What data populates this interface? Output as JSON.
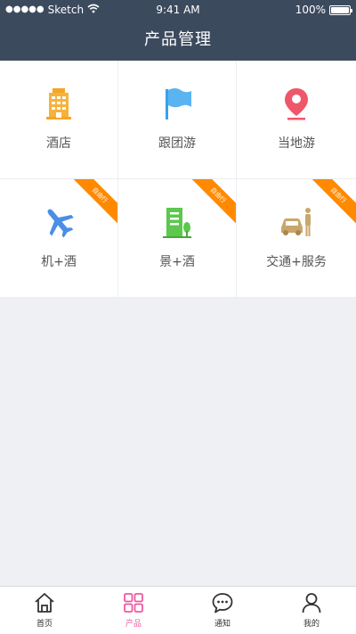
{
  "status_bar": {
    "carrier": "Sketch",
    "time": "9:41 AM",
    "battery": "100%"
  },
  "header": {
    "title": "产品管理"
  },
  "products": [
    {
      "label": "酒店",
      "icon": "hotel-building-icon",
      "badge": ""
    },
    {
      "label": "跟团游",
      "icon": "flag-icon",
      "badge": ""
    },
    {
      "label": "当地游",
      "icon": "location-pin-icon",
      "badge": ""
    },
    {
      "label": "机+酒",
      "icon": "airplane-icon",
      "badge": "自由行"
    },
    {
      "label": "景+酒",
      "icon": "building-tree-icon",
      "badge": "自由行"
    },
    {
      "label": "交通+服务",
      "icon": "car-person-icon",
      "badge": "自由行"
    }
  ],
  "tabbar": {
    "tabs": [
      {
        "label": "首页",
        "icon": "home-icon",
        "active": false
      },
      {
        "label": "产品",
        "icon": "grid-icon",
        "active": true
      },
      {
        "label": "通知",
        "icon": "chat-bubble-icon",
        "active": false
      },
      {
        "label": "我的",
        "icon": "user-icon",
        "active": false
      }
    ]
  },
  "colors": {
    "header_bg": "#3c4a5e",
    "accent_active": "#ef5aa0",
    "badge_orange": "#ff8a00",
    "page_bg": "#eef0f4"
  }
}
